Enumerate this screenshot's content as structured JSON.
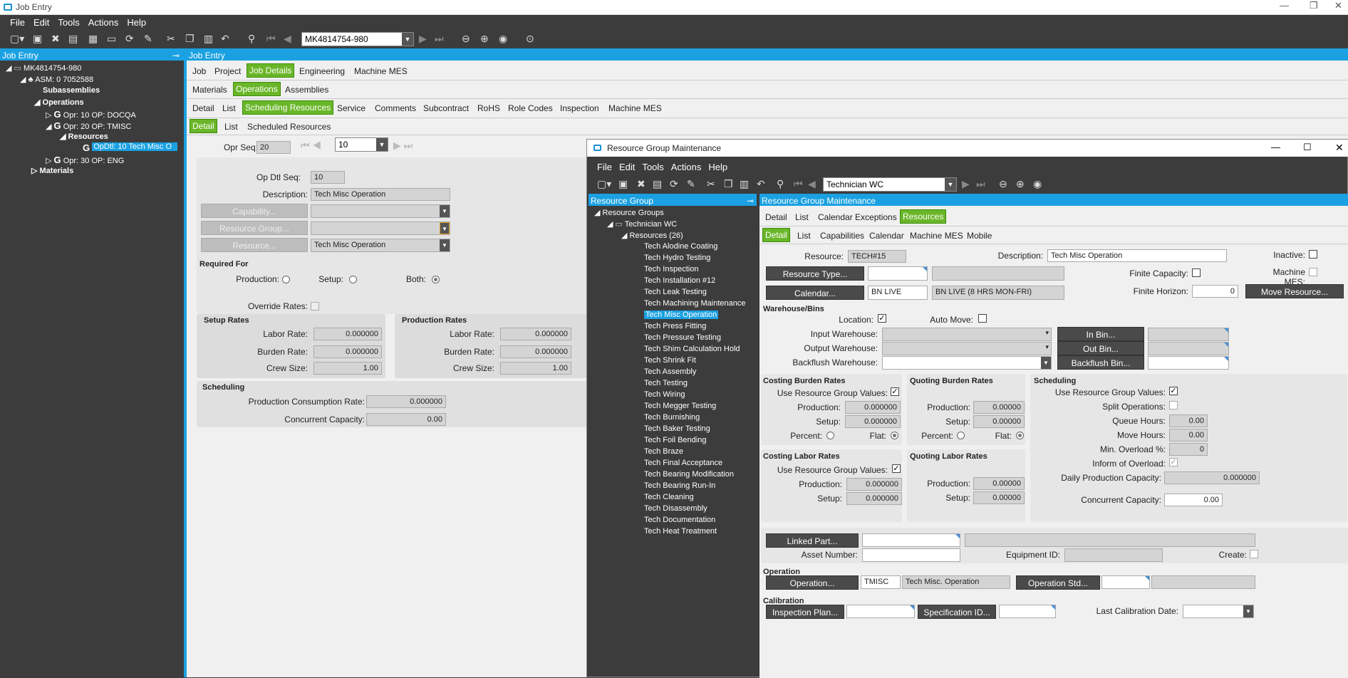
{
  "app": {
    "title": "Job Entry",
    "menu": [
      "File",
      "Edit",
      "Tools",
      "Actions",
      "Help"
    ],
    "job_combo": "MK4814754-980"
  },
  "left_panel": {
    "header": "Job Entry",
    "tree": [
      "MK4814754-980",
      "ASM: 0 7052588",
      "Subassemblies",
      "Operations",
      "Opr: 10 OP: DOCQA",
      "Opr: 20 OP: TMISC",
      "Resources",
      "OpDtl: 10 Tech Misc O",
      "Opr: 30 OP: ENG",
      "Materials"
    ]
  },
  "main": {
    "header": "Job Entry",
    "tabs1": [
      "Job",
      "Project",
      "Job Details",
      "Engineering",
      "Machine MES"
    ],
    "tabs2": [
      "Materials",
      "Operations",
      "Assemblies"
    ],
    "tabs3": [
      "Detail",
      "List",
      "Scheduling Resources",
      "Service",
      "Comments",
      "Subcontract",
      "RoHS",
      "Role Codes",
      "Inspection",
      "Machine MES"
    ],
    "tabs4": [
      "Detail",
      "List",
      "Scheduled Resources"
    ],
    "opr_seq_label": "Opr Seq:",
    "opr_seq": "20",
    "opr_combo": "10",
    "op_dtl_seq_label": "Op Dtl Seq:",
    "op_dtl_seq": "10",
    "description_label": "Description:",
    "description": "Tech Misc Operation",
    "capability_btn": "Capability...",
    "resource_group_btn": "Resource Group...",
    "resource_btn": "Resource...",
    "resource_value": "Tech Misc Operation",
    "required_for": "Required For",
    "production": "Production:",
    "setup": "Setup:",
    "both": "Both:",
    "override_rates": "Override Rates:",
    "setup_rates": "Setup Rates",
    "production_rates": "Production Rates",
    "labor_rate": "Labor Rate:",
    "burden_rate": "Burden Rate:",
    "crew_size": "Crew Size:",
    "setup_labor": "0.000000",
    "setup_burden": "0.000000",
    "setup_crew": "1.00",
    "prod_labor": "0.000000",
    "prod_burden": "0.000000",
    "prod_crew": "1.00",
    "scheduling": "Scheduling",
    "prod_consumption_label": "Production Consumption Rate:",
    "prod_consumption": "0.000000",
    "concurrent_label": "Concurrent Capacity:",
    "concurrent": "0.00"
  },
  "rgm": {
    "title": "Resource Group Maintenance",
    "menu": [
      "File",
      "Edit",
      "Tools",
      "Actions",
      "Help"
    ],
    "combo": "Technician WC",
    "left_header": "Resource Group",
    "right_header": "Resource Group Maintenance",
    "tree_root": "Resource Groups",
    "tree_group": "Technician WC",
    "tree_resources": "Resources (26)",
    "resources": [
      "Tech Alodine Coating",
      "Tech Hydro Testing",
      "Tech Inspection",
      "Tech Installation #12",
      "Tech Leak Testing",
      "Tech Machining Maintenance",
      "Tech Misc Operation",
      "Tech Press Fitting",
      "Tech Pressure Testing",
      "Tech Shim Calculation Hold",
      "Tech Shrink Fit",
      "Tech Assembly",
      "Tech Testing",
      "Tech Wiring",
      "Tech Megger Testing",
      "Tech Burnishing",
      "Tech Baker Testing",
      "Tech Foil Bending",
      "Tech Braze",
      "Tech Final Acceptance",
      "Tech Bearing Modification",
      "Tech Bearing Run-In",
      "Tech Cleaning",
      "Tech Disassembly",
      "Tech Documentation",
      "Tech Heat Treatment"
    ],
    "tabs1": [
      "Detail",
      "List",
      "Calendar Exceptions",
      "Resources"
    ],
    "tabs2": [
      "Detail",
      "List",
      "Capabilities",
      "Calendar",
      "Machine MES",
      "Mobile"
    ],
    "resource_label": "Resource:",
    "resource": "TECH#15",
    "desc_label": "Description:",
    "desc": "Tech Misc Operation",
    "inactive": "Inactive:",
    "resource_type_btn": "Resource Type...",
    "finite_capacity": "Finite Capacity:",
    "machine_mes": "Machine MES:",
    "calendar_btn": "Calendar...",
    "calendar": "BN LIVE",
    "calendar_desc": "BN LIVE (8 HRS MON-FRI)",
    "finite_horizon": "Finite Horizon:",
    "finite_horizon_val": "0",
    "move_resource_btn": "Move Resource...",
    "warehouse_bins": "Warehouse/Bins",
    "location": "Location:",
    "auto_move": "Auto Move:",
    "input_wh": "Input Warehouse:",
    "output_wh": "Output Warehouse:",
    "backflush_wh": "Backflush Warehouse:",
    "in_bin": "In Bin...",
    "out_bin": "Out Bin...",
    "backflush_bin": "Backflush Bin...",
    "costing_burden": "Costing Burden Rates",
    "quoting_burden": "Quoting Burden Rates",
    "sched": "Scheduling",
    "use_rg_values": "Use Resource Group Values:",
    "production": "Production:",
    "setup": "Setup:",
    "percent": "Percent:",
    "flat": "Flat:",
    "cb_prod": "0.000000",
    "cb_setup": "0.000000",
    "qb_prod": "0.00000",
    "qb_setup": "0.00000",
    "split_ops": "Split Operations:",
    "queue_hours": "Queue Hours:",
    "queue_val": "0.00",
    "move_hours": "Move Hours:",
    "move_val": "0.00",
    "min_overload": "Min. Overload %:",
    "min_overload_val": "0",
    "inform_overload": "Inform of Overload:",
    "daily_cap": "Daily Production Capacity:",
    "daily_cap_val": "0.000000",
    "conc_cap": "Concurrent Capacity:",
    "conc_cap_val": "0.00",
    "costing_labor": "Costing Labor Rates",
    "quoting_labor": "Quoting Labor Rates",
    "cl_prod": "0.000000",
    "cl_setup": "0.000000",
    "ql_prod": "0.00000",
    "ql_setup": "0.00000",
    "linked_part_btn": "Linked Part...",
    "asset_number": "Asset Number:",
    "equipment_id": "Equipment ID:",
    "create": "Create:",
    "operation": "Operation",
    "operation_btn": "Operation...",
    "op_code": "TMISC",
    "op_desc": "Tech Misc. Operation",
    "op_std_btn": "Operation Std...",
    "calibration": "Calibration",
    "inspection_plan_btn": "Inspection Plan...",
    "spec_id_btn": "Specification ID...",
    "last_cal": "Last Calibration Date:"
  }
}
